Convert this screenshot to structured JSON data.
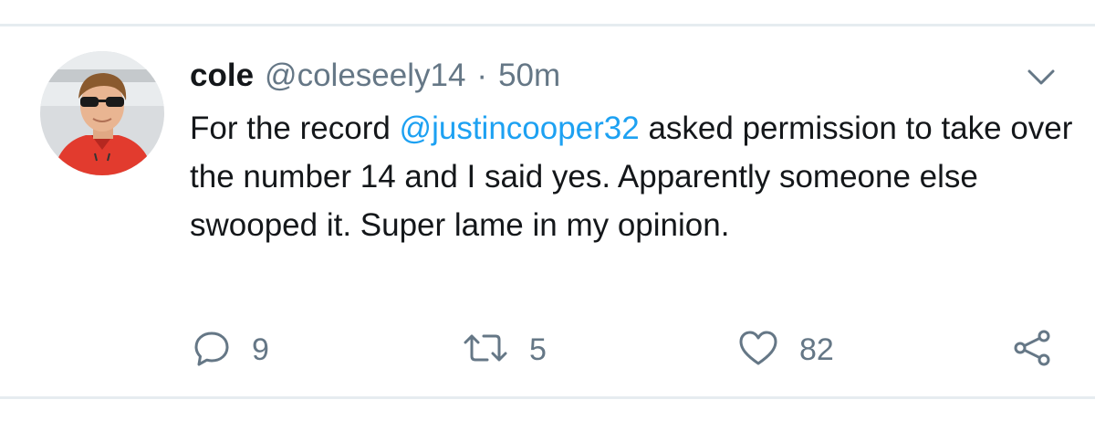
{
  "tweet": {
    "author_name": "cole",
    "author_handle": "@coleseely14",
    "separator": "·",
    "time": "50m",
    "text_before": "For the record ",
    "mention": "@justincooper32",
    "text_after": " asked permission to take over the number 14 and I said yes. Apparently someone else swooped it. Super lame in my opinion."
  },
  "actions": {
    "reply_count": "9",
    "retweet_count": "5",
    "like_count": "82"
  },
  "icons": {
    "menu": "chevron-down-icon",
    "reply": "reply-icon",
    "retweet": "retweet-icon",
    "like": "heart-icon",
    "share": "share-icon"
  },
  "colors": {
    "mention": "#1da1f2",
    "muted": "#657786",
    "text": "#14171a",
    "divider": "#e6ecf0"
  }
}
